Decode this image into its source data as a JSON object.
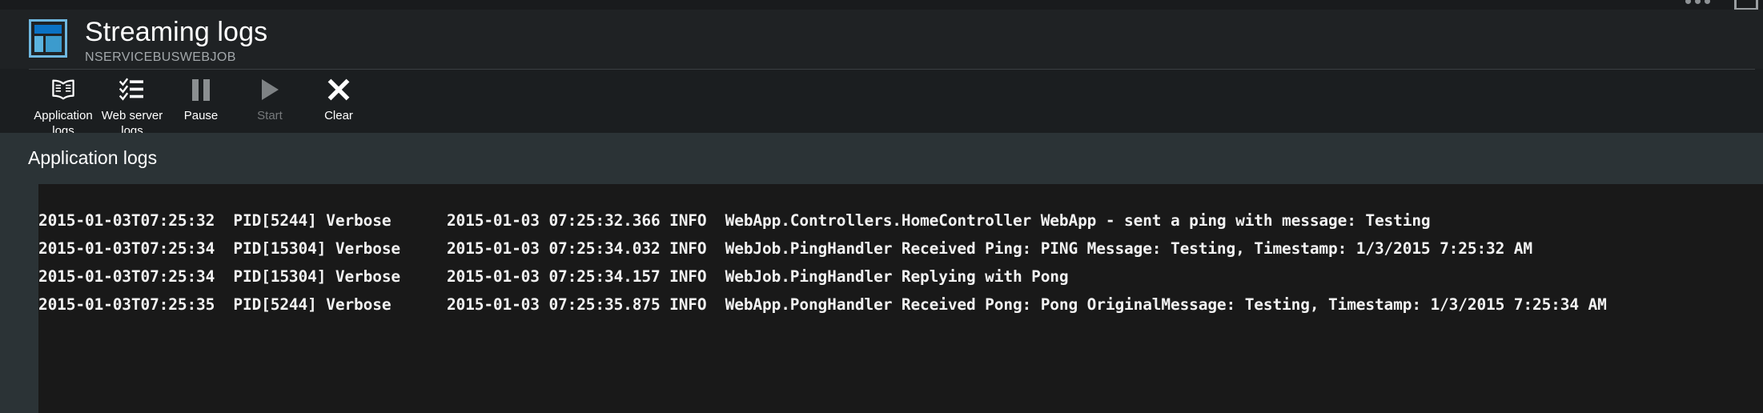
{
  "window_controls": {
    "more_icon": "ellipsis-icon",
    "restore_icon": "restore-window-icon"
  },
  "header": {
    "icon": "web-app-icon",
    "title": "Streaming logs",
    "subtitle": "NSERVICEBUSWEBJOB"
  },
  "toolbar": {
    "items": [
      {
        "label": "Application logs",
        "icon": "book-icon",
        "disabled": false
      },
      {
        "label": "Web server logs",
        "icon": "checklist-icon",
        "disabled": false
      },
      {
        "label": "Pause",
        "icon": "pause-icon",
        "disabled": false
      },
      {
        "label": "Start",
        "icon": "play-icon",
        "disabled": true
      },
      {
        "label": "Clear",
        "icon": "close-x-icon",
        "disabled": false
      }
    ]
  },
  "section": {
    "title": "Application logs"
  },
  "console": {
    "lines": [
      "2015-01-03T07:25:32  PID[5244] Verbose      2015-01-03 07:25:32.366 INFO  WebApp.Controllers.HomeController WebApp - sent a ping with message: Testing",
      "2015-01-03T07:25:34  PID[15304] Verbose     2015-01-03 07:25:34.032 INFO  WebJob.PingHandler Received Ping: PING Message: Testing, Timestamp: 1/3/2015 7:25:32 AM",
      "2015-01-03T07:25:34  PID[15304] Verbose     2015-01-03 07:25:34.157 INFO  WebJob.PingHandler Replying with Pong",
      "2015-01-03T07:25:35  PID[5244] Verbose      2015-01-03 07:25:35.875 INFO  WebApp.PongHandler Received Pong: Pong OriginalMessage: Testing, Timestamp: 1/3/2015 7:25:34 AM"
    ]
  },
  "colors": {
    "accent_blue": "#0b72c4",
    "icon_border_blue": "#6fb8e0",
    "panel_bg": "#2b3336",
    "header_bg": "#1f2224",
    "console_bg": "#191919"
  }
}
